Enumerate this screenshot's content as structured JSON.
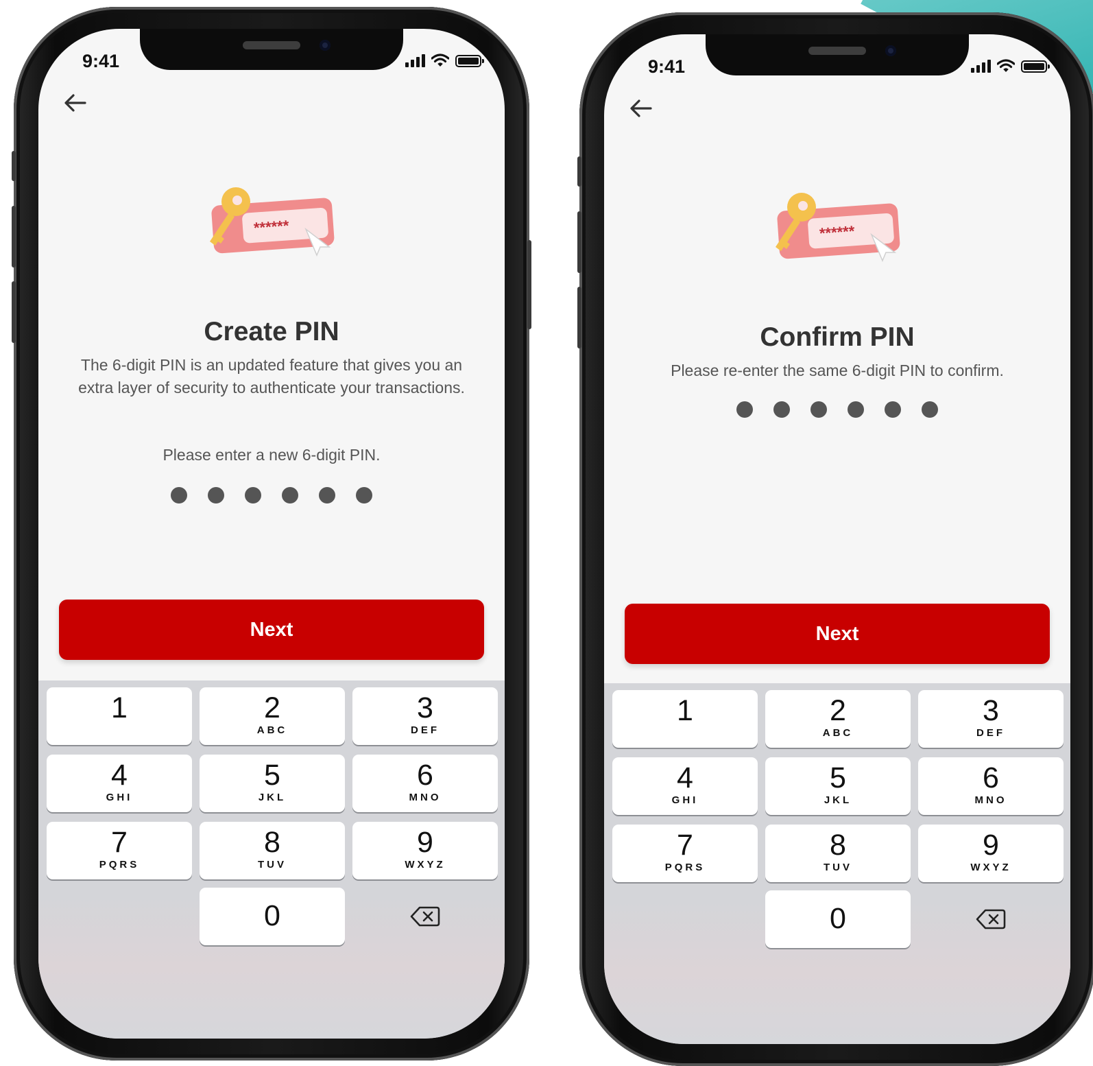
{
  "screens": [
    {
      "status_time": "9:41",
      "title": "Create PIN",
      "description": "The 6-digit PIN is an updated feature that gives you an extra layer of security to authenticate your transactions.",
      "prompt": "Please enter a new 6-digit PIN.",
      "pin_mask_text": "******",
      "pin_dots_filled": 6,
      "next_label": "Next"
    },
    {
      "status_time": "9:41",
      "title": "Confirm PIN",
      "description": "Please re-enter the same 6-digit PIN to confirm.",
      "pin_mask_text": "******",
      "pin_dots_filled": 6,
      "next_label": "Next"
    }
  ],
  "keypad": [
    {
      "num": "1",
      "letters": ""
    },
    {
      "num": "2",
      "letters": "ABC"
    },
    {
      "num": "3",
      "letters": "DEF"
    },
    {
      "num": "4",
      "letters": "GHI"
    },
    {
      "num": "5",
      "letters": "JKL"
    },
    {
      "num": "6",
      "letters": "MNO"
    },
    {
      "num": "7",
      "letters": "PQRS"
    },
    {
      "num": "8",
      "letters": "TUV"
    },
    {
      "num": "9",
      "letters": "WXYZ"
    },
    {
      "num": "0",
      "letters": ""
    }
  ],
  "icons": {
    "back": "arrow-left-icon",
    "delete": "backspace-icon",
    "signal": "cellular-signal-icon",
    "wifi": "wifi-icon",
    "battery": "battery-icon",
    "illustration": "key-password-illustration"
  },
  "colors": {
    "primary_button": "#c80000",
    "screen_background": "#f6f6f6",
    "keypad_background": "#d4d5d9",
    "pin_dot": "#555555",
    "accent_corner": "#2fb3b1"
  }
}
